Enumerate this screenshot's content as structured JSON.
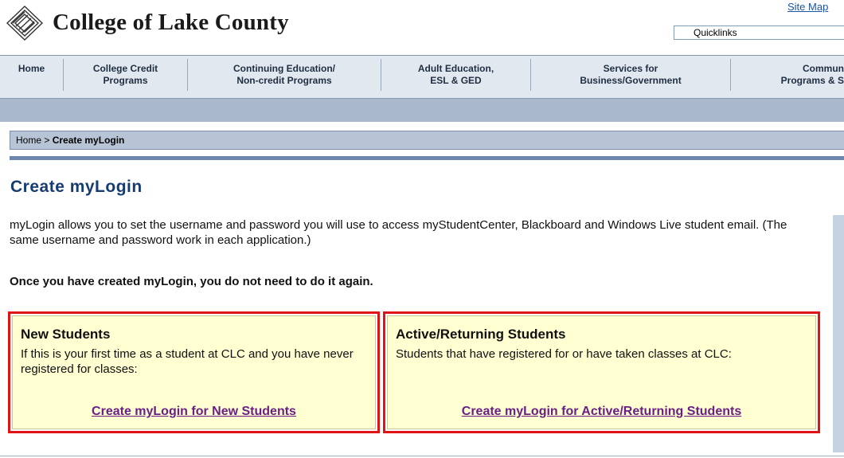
{
  "header": {
    "brand": "College of Lake County",
    "site_map": "Site Map",
    "quicklinks": "Quicklinks"
  },
  "nav": {
    "items": [
      {
        "label": "Home"
      },
      {
        "label": "College Credit\nPrograms"
      },
      {
        "label": "Continuing Education/\nNon-credit Programs"
      },
      {
        "label": "Adult Education,\nESL & GED"
      },
      {
        "label": "Services for\nBusiness/Government"
      },
      {
        "label": "Commun\nPrograms & S"
      }
    ]
  },
  "breadcrumb": {
    "home": "Home",
    "separator": " > ",
    "current": "Create myLogin"
  },
  "main": {
    "title": "Create myLogin",
    "intro": "myLogin allows you to set the username and password you will use to access myStudentCenter, Blackboard and Windows Live student email. (The same username and password work in each application.)",
    "note": "Once you have created myLogin, you do not need to do it again."
  },
  "cards": [
    {
      "heading": "New Students",
      "text": "If this is your first time as a student at CLC and you have never registered for classes:",
      "link": "Create myLogin for New Students"
    },
    {
      "heading": "Active/Returning Students",
      "text": "Students that have registered for or have taken classes at CLC:",
      "link": "Create myLogin for Active/Returning Students"
    }
  ],
  "colors": {
    "title": "#163c72",
    "highlight_border": "#e01414",
    "card_bg": "#ffffd2",
    "link": "#6b1f86",
    "nav_bg": "#e1e8ef"
  }
}
